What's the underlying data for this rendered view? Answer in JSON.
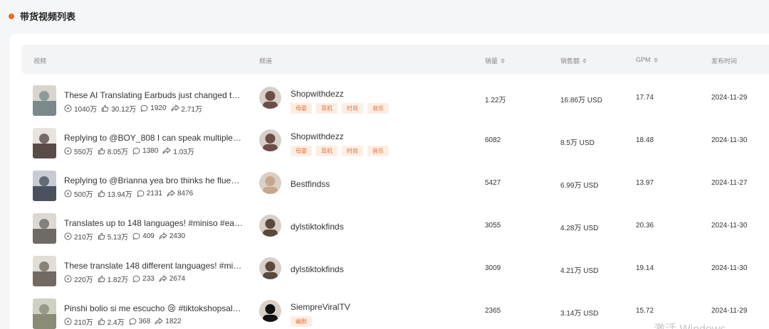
{
  "section": {
    "title": "带货视频列表"
  },
  "columns": {
    "video": "视频",
    "channel": "频道",
    "sales": "销量",
    "amount": "销售额",
    "gpm": "GPM",
    "date": "发布时间"
  },
  "rows": [
    {
      "title": "These AI Translating Earbuds just changed the game…",
      "views": "1040万",
      "likes": "30.12万",
      "comments": "1920",
      "shares": "2.71万",
      "channel": "Shopwithdezz",
      "tags": [
        "母婴",
        "耳机",
        "时尚",
        "音乐"
      ],
      "sales": "1.22万",
      "amount": "16.86万 USD",
      "gpm": "17.74",
      "date": "2024-11-29"
    },
    {
      "title": "Replying to @BOY_808 I can speak multiple languages…",
      "views": "550万",
      "likes": "8.05万",
      "comments": "1380",
      "shares": "1.03万",
      "channel": "Shopwithdezz",
      "tags": [
        "母婴",
        "耳机",
        "时尚",
        "音乐"
      ],
      "sales": "6082",
      "amount": "8.5万 USD",
      "gpm": "18.48",
      "date": "2024-11-30"
    },
    {
      "title": "Replying to @Brianna yea bro thinks he fluent…",
      "views": "500万",
      "likes": "13.94万",
      "comments": "2131",
      "shares": "8476",
      "channel": "Bestfindss",
      "tags": [],
      "sales": "5427",
      "amount": "6.99万 USD",
      "gpm": "13.97",
      "date": "2024-11-27"
    },
    {
      "title": "Translates up to 148 languages! #miniso #earbuds…",
      "views": "210万",
      "likes": "5.13万",
      "comments": "409",
      "shares": "2430",
      "channel": "dylstiktokfinds",
      "tags": [],
      "sales": "3055",
      "amount": "4.28万 USD",
      "gpm": "20.36",
      "date": "2024-11-30"
    },
    {
      "title": "These translate 148 different languages! #miniso…",
      "views": "220万",
      "likes": "1.82万",
      "comments": "233",
      "shares": "2674",
      "channel": "dylstiktokfinds",
      "tags": [],
      "sales": "3009",
      "amount": "4.21万 USD",
      "gpm": "19.14",
      "date": "2024-11-30"
    },
    {
      "title": "Pinshi bolio si me escucho 😢 #tiktokshopsale…",
      "views": "210万",
      "likes": "2.4万",
      "comments": "368",
      "shares": "1822",
      "channel": "SiempreViralTV",
      "tags": [
        "幽默"
      ],
      "sales": "2365",
      "amount": "3.14万 USD",
      "gpm": "15.72",
      "date": "2024-11-29"
    }
  ],
  "colors": {
    "accent": "#ef6a27",
    "tag_bg": "#fdeee4",
    "tag_text": "#ee6b2f"
  },
  "watermark": "激活 Windows"
}
